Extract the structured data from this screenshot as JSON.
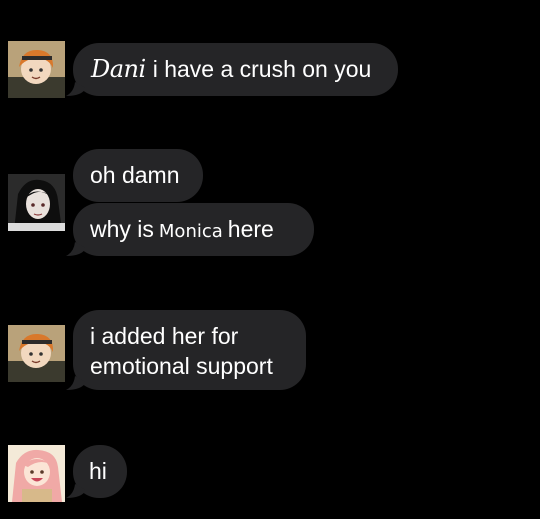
{
  "conversation": {
    "messages": [
      {
        "sender_avatar": "dani-avatar",
        "name_tag": "Dani",
        "text": "i have a crush on you"
      },
      {
        "sender_avatar": "dark-hair-avatar",
        "text": "oh damn"
      },
      {
        "prefix": "why is",
        "name_tag": "Monica",
        "suffix": "here"
      },
      {
        "sender_avatar": "dani-avatar",
        "line1": "i added her for",
        "line2": "emotional support"
      },
      {
        "sender_avatar": "monica-avatar",
        "text": "hi"
      }
    ]
  },
  "colors": {
    "background": "#000000",
    "bubble": "#252527",
    "text": "#ffffff"
  }
}
